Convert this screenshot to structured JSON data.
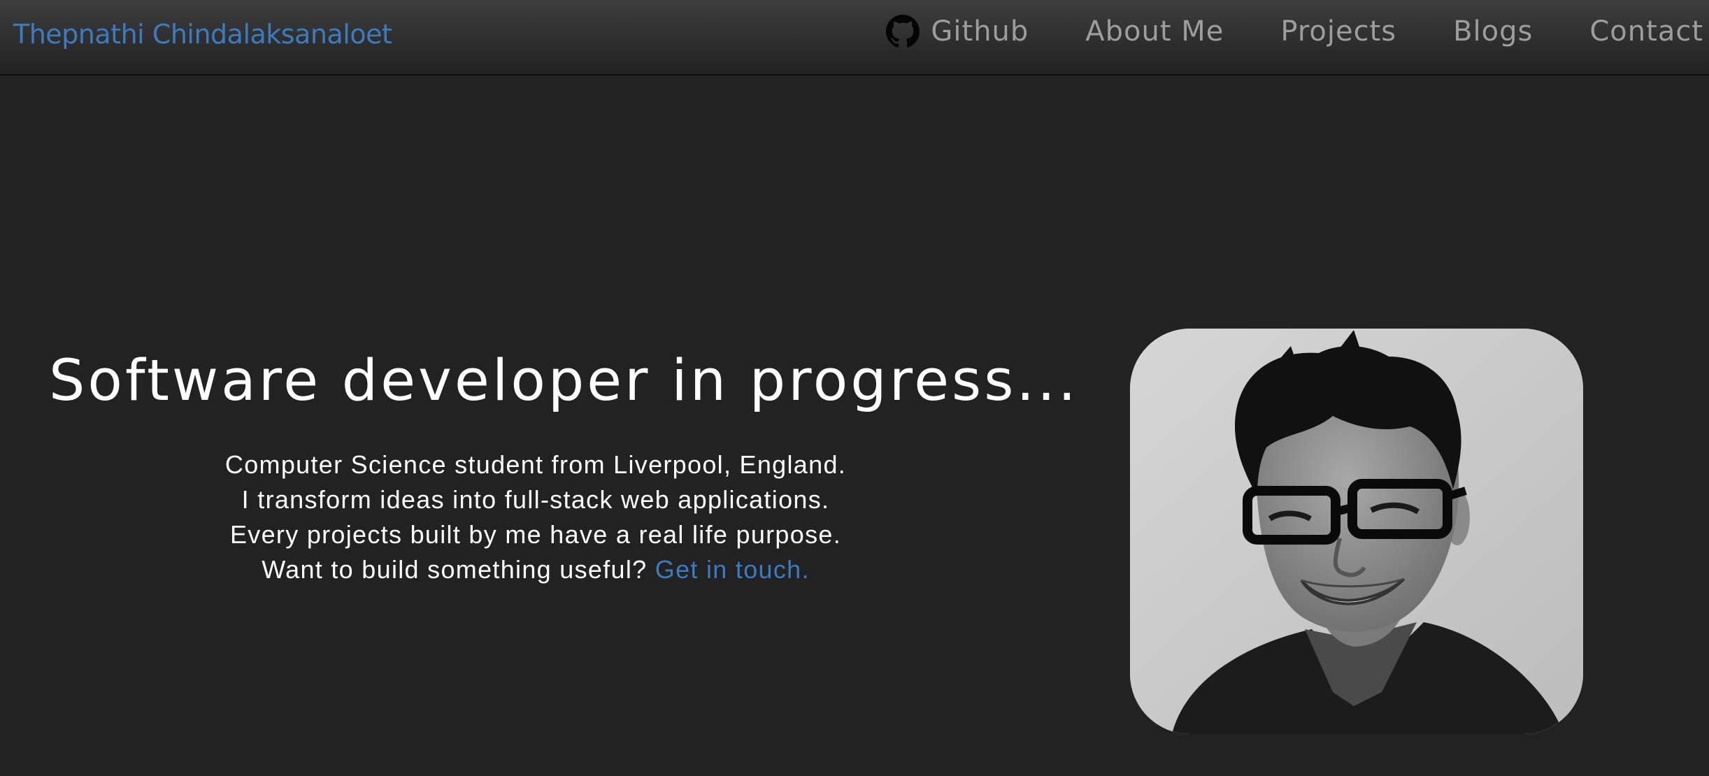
{
  "navbar": {
    "brand": "Thepnathi Chindalaksanaloet",
    "links": [
      {
        "label": "Github",
        "icon": "github-icon"
      },
      {
        "label": "About Me"
      },
      {
        "label": "Projects"
      },
      {
        "label": "Blogs"
      },
      {
        "label": "Contact"
      }
    ]
  },
  "hero": {
    "title": "Software developer in progress...",
    "lines": [
      "Computer Science student from Liverpool, England.",
      "I transform ideas into full-stack web applications.",
      "Every projects built by me have a real life purpose.",
      "Want to build something useful?"
    ],
    "cta": "Get in touch."
  },
  "colors": {
    "background": "#222222",
    "accent": "#3c7bbf",
    "nav_text": "#9d9d9d"
  }
}
